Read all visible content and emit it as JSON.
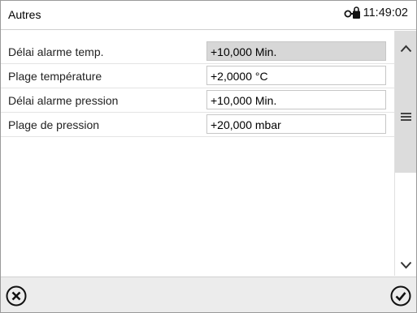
{
  "header": {
    "title": "Autres",
    "time": "11:49:02",
    "lock_icon": "key-lock-icon"
  },
  "settings": [
    {
      "label": "Délai alarme temp.",
      "value": "+10,000 Min.",
      "selected": true
    },
    {
      "label": "Plage température",
      "value": "+2,0000 °C",
      "selected": false
    },
    {
      "label": "Délai alarme pression",
      "value": "+10,000 Min.",
      "selected": false
    },
    {
      "label": "Plage de pression",
      "value": "+20,000 mbar",
      "selected": false
    }
  ],
  "scrollbar": {
    "up_icon": "chevron-up-icon",
    "grip_icon": "menu-lines-icon",
    "down_icon": "chevron-down-icon"
  },
  "footer": {
    "cancel_icon": "close-circle-icon",
    "confirm_icon": "check-circle-icon"
  }
}
